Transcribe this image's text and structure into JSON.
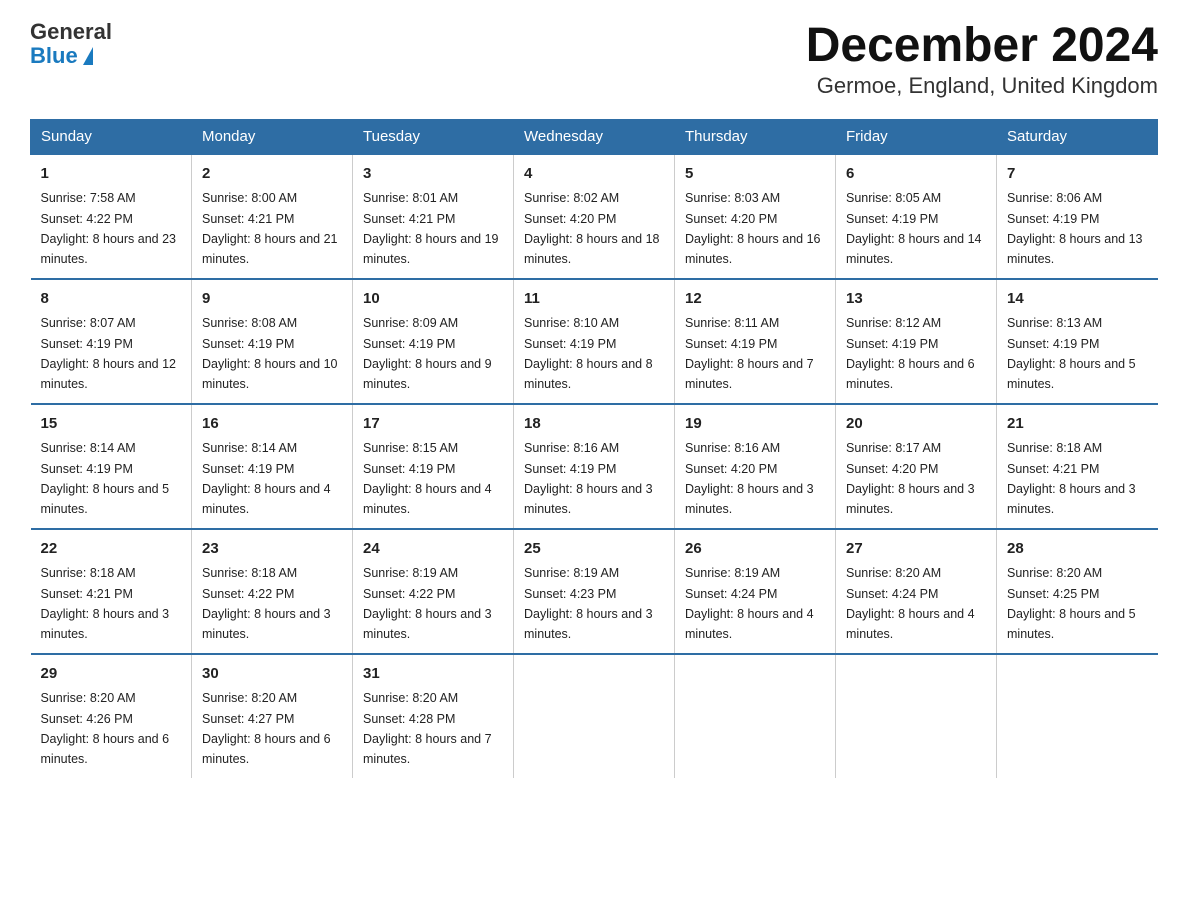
{
  "logo": {
    "general": "General",
    "blue": "Blue"
  },
  "title": "December 2024",
  "subtitle": "Germoe, England, United Kingdom",
  "days_of_week": [
    "Sunday",
    "Monday",
    "Tuesday",
    "Wednesday",
    "Thursday",
    "Friday",
    "Saturday"
  ],
  "weeks": [
    [
      {
        "day": "1",
        "sunrise": "Sunrise: 7:58 AM",
        "sunset": "Sunset: 4:22 PM",
        "daylight": "Daylight: 8 hours and 23 minutes."
      },
      {
        "day": "2",
        "sunrise": "Sunrise: 8:00 AM",
        "sunset": "Sunset: 4:21 PM",
        "daylight": "Daylight: 8 hours and 21 minutes."
      },
      {
        "day": "3",
        "sunrise": "Sunrise: 8:01 AM",
        "sunset": "Sunset: 4:21 PM",
        "daylight": "Daylight: 8 hours and 19 minutes."
      },
      {
        "day": "4",
        "sunrise": "Sunrise: 8:02 AM",
        "sunset": "Sunset: 4:20 PM",
        "daylight": "Daylight: 8 hours and 18 minutes."
      },
      {
        "day": "5",
        "sunrise": "Sunrise: 8:03 AM",
        "sunset": "Sunset: 4:20 PM",
        "daylight": "Daylight: 8 hours and 16 minutes."
      },
      {
        "day": "6",
        "sunrise": "Sunrise: 8:05 AM",
        "sunset": "Sunset: 4:19 PM",
        "daylight": "Daylight: 8 hours and 14 minutes."
      },
      {
        "day": "7",
        "sunrise": "Sunrise: 8:06 AM",
        "sunset": "Sunset: 4:19 PM",
        "daylight": "Daylight: 8 hours and 13 minutes."
      }
    ],
    [
      {
        "day": "8",
        "sunrise": "Sunrise: 8:07 AM",
        "sunset": "Sunset: 4:19 PM",
        "daylight": "Daylight: 8 hours and 12 minutes."
      },
      {
        "day": "9",
        "sunrise": "Sunrise: 8:08 AM",
        "sunset": "Sunset: 4:19 PM",
        "daylight": "Daylight: 8 hours and 10 minutes."
      },
      {
        "day": "10",
        "sunrise": "Sunrise: 8:09 AM",
        "sunset": "Sunset: 4:19 PM",
        "daylight": "Daylight: 8 hours and 9 minutes."
      },
      {
        "day": "11",
        "sunrise": "Sunrise: 8:10 AM",
        "sunset": "Sunset: 4:19 PM",
        "daylight": "Daylight: 8 hours and 8 minutes."
      },
      {
        "day": "12",
        "sunrise": "Sunrise: 8:11 AM",
        "sunset": "Sunset: 4:19 PM",
        "daylight": "Daylight: 8 hours and 7 minutes."
      },
      {
        "day": "13",
        "sunrise": "Sunrise: 8:12 AM",
        "sunset": "Sunset: 4:19 PM",
        "daylight": "Daylight: 8 hours and 6 minutes."
      },
      {
        "day": "14",
        "sunrise": "Sunrise: 8:13 AM",
        "sunset": "Sunset: 4:19 PM",
        "daylight": "Daylight: 8 hours and 5 minutes."
      }
    ],
    [
      {
        "day": "15",
        "sunrise": "Sunrise: 8:14 AM",
        "sunset": "Sunset: 4:19 PM",
        "daylight": "Daylight: 8 hours and 5 minutes."
      },
      {
        "day": "16",
        "sunrise": "Sunrise: 8:14 AM",
        "sunset": "Sunset: 4:19 PM",
        "daylight": "Daylight: 8 hours and 4 minutes."
      },
      {
        "day": "17",
        "sunrise": "Sunrise: 8:15 AM",
        "sunset": "Sunset: 4:19 PM",
        "daylight": "Daylight: 8 hours and 4 minutes."
      },
      {
        "day": "18",
        "sunrise": "Sunrise: 8:16 AM",
        "sunset": "Sunset: 4:19 PM",
        "daylight": "Daylight: 8 hours and 3 minutes."
      },
      {
        "day": "19",
        "sunrise": "Sunrise: 8:16 AM",
        "sunset": "Sunset: 4:20 PM",
        "daylight": "Daylight: 8 hours and 3 minutes."
      },
      {
        "day": "20",
        "sunrise": "Sunrise: 8:17 AM",
        "sunset": "Sunset: 4:20 PM",
        "daylight": "Daylight: 8 hours and 3 minutes."
      },
      {
        "day": "21",
        "sunrise": "Sunrise: 8:18 AM",
        "sunset": "Sunset: 4:21 PM",
        "daylight": "Daylight: 8 hours and 3 minutes."
      }
    ],
    [
      {
        "day": "22",
        "sunrise": "Sunrise: 8:18 AM",
        "sunset": "Sunset: 4:21 PM",
        "daylight": "Daylight: 8 hours and 3 minutes."
      },
      {
        "day": "23",
        "sunrise": "Sunrise: 8:18 AM",
        "sunset": "Sunset: 4:22 PM",
        "daylight": "Daylight: 8 hours and 3 minutes."
      },
      {
        "day": "24",
        "sunrise": "Sunrise: 8:19 AM",
        "sunset": "Sunset: 4:22 PM",
        "daylight": "Daylight: 8 hours and 3 minutes."
      },
      {
        "day": "25",
        "sunrise": "Sunrise: 8:19 AM",
        "sunset": "Sunset: 4:23 PM",
        "daylight": "Daylight: 8 hours and 3 minutes."
      },
      {
        "day": "26",
        "sunrise": "Sunrise: 8:19 AM",
        "sunset": "Sunset: 4:24 PM",
        "daylight": "Daylight: 8 hours and 4 minutes."
      },
      {
        "day": "27",
        "sunrise": "Sunrise: 8:20 AM",
        "sunset": "Sunset: 4:24 PM",
        "daylight": "Daylight: 8 hours and 4 minutes."
      },
      {
        "day": "28",
        "sunrise": "Sunrise: 8:20 AM",
        "sunset": "Sunset: 4:25 PM",
        "daylight": "Daylight: 8 hours and 5 minutes."
      }
    ],
    [
      {
        "day": "29",
        "sunrise": "Sunrise: 8:20 AM",
        "sunset": "Sunset: 4:26 PM",
        "daylight": "Daylight: 8 hours and 6 minutes."
      },
      {
        "day": "30",
        "sunrise": "Sunrise: 8:20 AM",
        "sunset": "Sunset: 4:27 PM",
        "daylight": "Daylight: 8 hours and 6 minutes."
      },
      {
        "day": "31",
        "sunrise": "Sunrise: 8:20 AM",
        "sunset": "Sunset: 4:28 PM",
        "daylight": "Daylight: 8 hours and 7 minutes."
      },
      null,
      null,
      null,
      null
    ]
  ]
}
